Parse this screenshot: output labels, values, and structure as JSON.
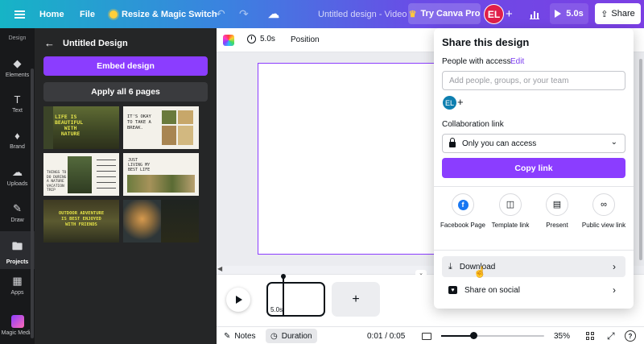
{
  "topbar": {
    "home": "Home",
    "file": "File",
    "resize": "Resize & Magic Switch",
    "title": "Untitled design - Video",
    "try_pro": "Try Canva Pro",
    "avatar": "EL",
    "play_duration": "5.0s",
    "share": "Share",
    "gradient": [
      "#16b4c6",
      "#7b3fe4"
    ]
  },
  "rail": {
    "design": "Design",
    "items": [
      {
        "label": "Elements",
        "icon": "shapes-icon"
      },
      {
        "label": "Text",
        "icon": "text-icon"
      },
      {
        "label": "Brand",
        "icon": "brand-icon"
      },
      {
        "label": "Uploads",
        "icon": "upload-icon"
      },
      {
        "label": "Draw",
        "icon": "draw-icon"
      },
      {
        "label": "Projects",
        "icon": "folder-icon"
      },
      {
        "label": "Apps",
        "icon": "apps-icon"
      },
      {
        "label": "Magic Media",
        "icon": "magic-icon"
      }
    ]
  },
  "panel": {
    "title": "Untitled Design",
    "embed": "Embed design",
    "apply": "Apply all 6 pages",
    "thumbs": {
      "t1": "LIFE IS\nBEAUTIFUL\n   WITH\n  NATURE",
      "t2": "IT'S OKAY\nTO TAKE A\nBREAK.",
      "t3": "THINGS TO\nDO DURING\nA NATURE\nVACATION\nTRIP",
      "t4": "JUST\nLIVING MY\nBEST LIFE",
      "t5": "OUTDOOR ADVENTURE\nIS BEST ENJOYED\nWITH FRIENDS"
    }
  },
  "canvas_toolbar": {
    "duration": "5.0s",
    "position": "Position"
  },
  "timeline": {
    "clip_duration": "5.0s",
    "add": "+"
  },
  "bottombar": {
    "notes": "Notes",
    "duration": "Duration",
    "time": "0:01 / 0:05",
    "zoom": "35%",
    "zoom_fraction": 0.31
  },
  "share": {
    "title": "Share this design",
    "people_label": "People with access",
    "edit": "Edit",
    "input_placeholder": "Add people, groups, or your team",
    "avatar": "EL",
    "collab_label": "Collaboration link",
    "access": "Only you can access",
    "copy": "Copy link",
    "options": [
      {
        "label": "Facebook Page",
        "icon": "facebook-icon"
      },
      {
        "label": "Template link",
        "icon": "template-icon"
      },
      {
        "label": "Present",
        "icon": "present-icon"
      },
      {
        "label": "Public view link",
        "icon": "link-icon"
      }
    ],
    "rows": [
      {
        "label": "Download",
        "icon": "download-icon"
      },
      {
        "label": "Share on social",
        "icon": "heart-icon"
      }
    ],
    "accent": "#8b3dff"
  }
}
